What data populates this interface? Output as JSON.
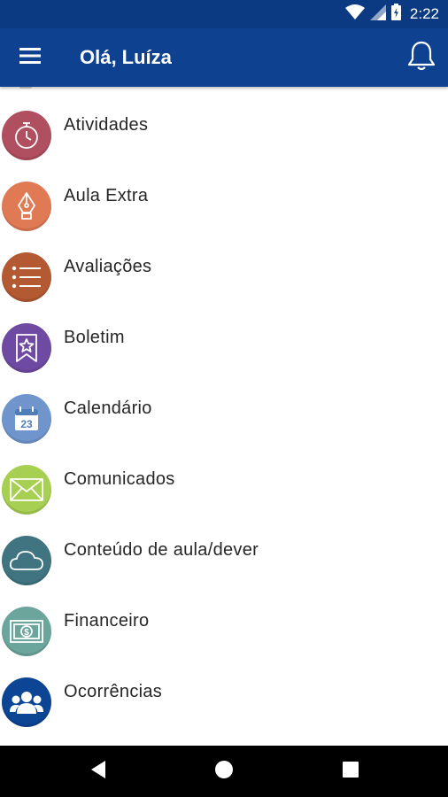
{
  "status_bar": {
    "time": "2:22",
    "icons": [
      "wifi-icon",
      "cell-signal-icon",
      "battery-icon"
    ]
  },
  "app_bar": {
    "title": "Olá, Luíza",
    "menu_icon": "hamburger-menu-icon",
    "notifications_icon": "bell-icon",
    "color": "#0e4290"
  },
  "menu": {
    "items": [
      {
        "label": "Atividades",
        "icon": "stopwatch-icon",
        "color": "#b04f5f"
      },
      {
        "label": "Aula Extra",
        "icon": "fountain-pen-icon",
        "color": "#e07a54"
      },
      {
        "label": "Avaliações",
        "icon": "list-icon",
        "color": "#b35a32"
      },
      {
        "label": "Boletim",
        "icon": "star-ribbon-icon",
        "color": "#6f4aa3"
      },
      {
        "label": "Calendário",
        "icon": "calendar-icon",
        "color": "#6f95cc"
      },
      {
        "label": "Comunicados",
        "icon": "envelope-icon",
        "color": "#a7cf52"
      },
      {
        "label": "Conteúdo de aula/dever",
        "icon": "cloud-icon",
        "color": "#3f7480"
      },
      {
        "label": "Financeiro",
        "icon": "money-bill-icon",
        "color": "#6ba59c"
      },
      {
        "label": "Ocorrências",
        "icon": "users-group-icon",
        "color": "#0d4595"
      }
    ]
  },
  "calendar_day": "23",
  "nav_bar": {
    "icons": [
      "back-triangle-icon",
      "home-circle-icon",
      "recents-square-icon"
    ]
  }
}
